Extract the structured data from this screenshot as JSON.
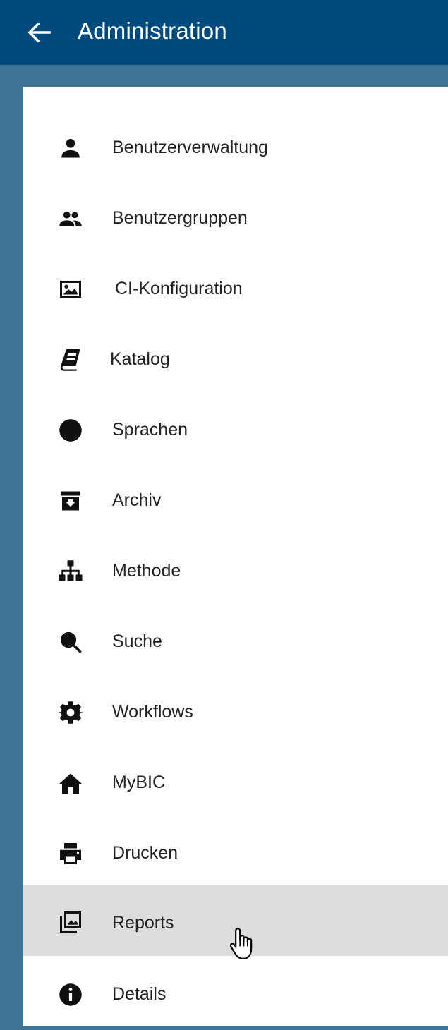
{
  "header": {
    "title": "Administration",
    "background": "#014a7d"
  },
  "menu": {
    "items": [
      {
        "label": "Benutzerverwaltung",
        "icon": "person-icon"
      },
      {
        "label": "Benutzergruppen",
        "icon": "group-icon"
      },
      {
        "label": "CI-Konfiguration",
        "icon": "image-icon"
      },
      {
        "label": "Katalog",
        "icon": "book-icon"
      },
      {
        "label": "Sprachen",
        "icon": "globe-icon"
      },
      {
        "label": "Archiv",
        "icon": "archive-icon"
      },
      {
        "label": "Methode",
        "icon": "sitemap-icon"
      },
      {
        "label": "Suche",
        "icon": "search-icon"
      },
      {
        "label": "Workflows",
        "icon": "gear-icon"
      },
      {
        "label": "MyBIC",
        "icon": "home-icon"
      },
      {
        "label": "Drucken",
        "icon": "print-icon"
      },
      {
        "label": "Reports",
        "icon": "photo-library-icon",
        "state": "hovered"
      },
      {
        "label": "Details",
        "icon": "info-icon"
      }
    ]
  },
  "colors": {
    "frame": "#3f7398",
    "hover": "#dcdcdc"
  }
}
